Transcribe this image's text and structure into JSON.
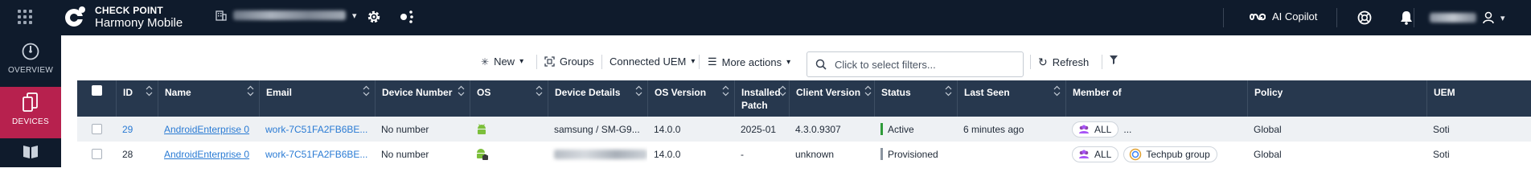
{
  "header": {
    "brand_line1": "CHECK POINT",
    "brand_line2": "Harmony Mobile",
    "copilot_label": "AI Copilot",
    "icons": [
      "apps-grid-icon",
      "checkpoint-logo-icon",
      "building-icon",
      "gear-icon",
      "share-icon",
      "copilot-icon",
      "help-icon",
      "bell-icon",
      "user-icon"
    ]
  },
  "sidebar": {
    "items": [
      {
        "label": "OVERVIEW",
        "icon": "speedometer-icon"
      },
      {
        "label": "DEVICES",
        "icon": "devices-icon",
        "active": true
      },
      {
        "label": "",
        "icon": "book-icon"
      }
    ],
    "active_color": "#b7214e"
  },
  "toolbar": {
    "new_label": "New",
    "groups_label": "Groups",
    "connected_uem_label": "Connected UEM",
    "more_actions_label": "More actions",
    "filter_placeholder": "Click to select filters...",
    "refresh_label": "Refresh"
  },
  "table": {
    "columns": [
      "ID",
      "Name",
      "Email",
      "Device Number",
      "OS",
      "Device Details",
      "OS Version",
      "Installed Patch",
      "Client Version",
      "Status",
      "Last Seen",
      "Member of",
      "Policy",
      "UEM"
    ],
    "installed_patch_lines": [
      "Installed",
      "Patch"
    ],
    "rows": [
      {
        "id": "29",
        "name": "AndroidEnterprise 0",
        "email": "work-7C51FA2FB6BE...",
        "device_number": "No number",
        "os_icon": "android-icon",
        "device_details": "samsung / SM-G9...",
        "os_version": "14.0.0",
        "installed_patch": "2025-01",
        "client_version": "4.3.0.9307",
        "status": "Active",
        "status_color": "#2e9b3a",
        "last_seen": "6 minutes ago",
        "member_of": [
          "ALL"
        ],
        "member_more": "...",
        "policy": "Global",
        "uem": "Soti"
      },
      {
        "id": "28",
        "name": "AndroidEnterprise 0",
        "email": "work-7C51FA2FB6BE...",
        "device_number": "No number",
        "os_icon": "android-work-icon",
        "device_details": "",
        "os_version": "14.0.0",
        "installed_patch": "-",
        "client_version": "unknown",
        "status": "Provisioned",
        "status_color": "#8a94a0",
        "last_seen": "",
        "member_of": [
          "ALL",
          "Techpub group"
        ],
        "member_more": "",
        "policy": "Global",
        "uem": "Soti"
      }
    ]
  },
  "colors": {
    "topbar": "#0f1b2c",
    "table_header": "#27384e",
    "link": "#2a7bd4",
    "android_green": "#7cbf3b"
  }
}
